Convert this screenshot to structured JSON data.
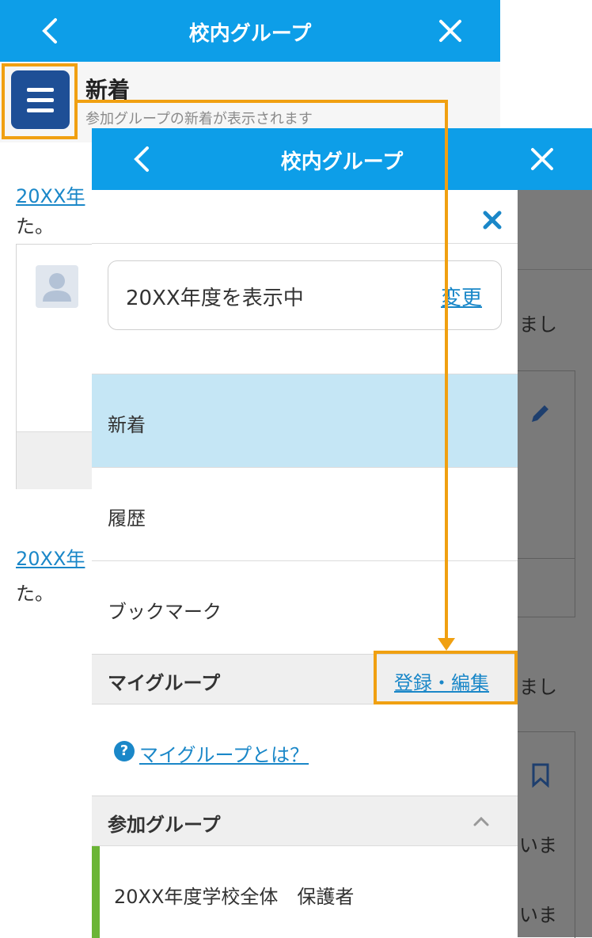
{
  "back_screen": {
    "header": {
      "title": "校内グループ",
      "back_icon": "chevron-left-icon",
      "close_icon": "close-icon"
    },
    "menu_icon": "hamburger-menu-icon",
    "page": {
      "title": "新着",
      "subtitle": "参加グループの新着が表示されます"
    },
    "feed": [
      {
        "link_text": "20XX年",
        "trail_text": "た。"
      },
      {
        "link_text": "20XX年",
        "trail_text": "た。"
      }
    ],
    "avatar_icon": "user-avatar-icon"
  },
  "front_screen": {
    "header": {
      "title": "校内グループ",
      "back_icon": "chevron-left-icon",
      "close_icon": "close-icon"
    },
    "drawer": {
      "close_icon": "close-x-icon",
      "year": {
        "label": "20XX年度を表示中",
        "change_label": "変更"
      },
      "nav_items": [
        {
          "label": "新着",
          "active": true
        },
        {
          "label": "履歴",
          "active": false
        },
        {
          "label": "ブックマーク",
          "active": false
        }
      ],
      "my_group": {
        "title": "マイグループ",
        "edit_label": "登録・編集",
        "help_icon": "question-circle-icon",
        "help_label": "マイグループとは？"
      },
      "joined_groups": {
        "title": "参加グループ",
        "collapse_icon": "chevron-up-icon",
        "items": [
          {
            "label": "20XX年度学校全体　保護者",
            "accent_color": "#6bb536"
          }
        ]
      }
    },
    "behind_fragments": [
      "まし",
      "まし",
      "いま",
      "いま"
    ],
    "behind_icons": [
      "pencil-icon",
      "bookmark-icon"
    ]
  },
  "colors": {
    "header": "#0d9ee8",
    "menu_button": "#1e4f96",
    "highlight": "#f0a011",
    "active_row": "#c5e6f5",
    "link": "#1a87c8"
  }
}
